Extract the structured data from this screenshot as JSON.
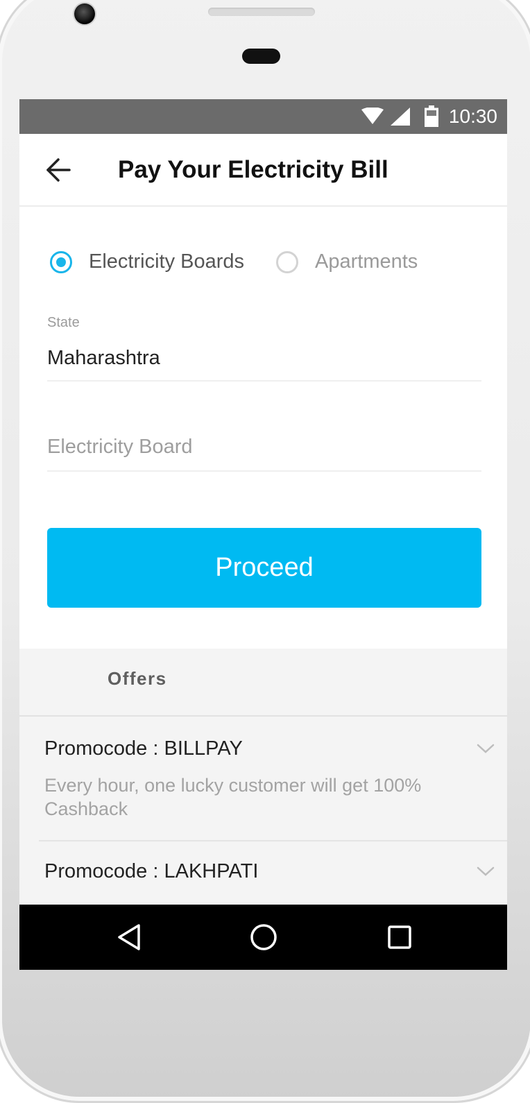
{
  "status_bar": {
    "time": "10:30",
    "icons": [
      "wifi-icon",
      "cellular-signal-icon",
      "battery-icon"
    ],
    "background": "#6b6b6b"
  },
  "app_bar": {
    "back_icon": "arrow-left-icon",
    "title": "Pay Your Electricity Bill"
  },
  "bill_type": {
    "options": [
      {
        "label": "Electricity Boards",
        "selected": true
      },
      {
        "label": "Apartments",
        "selected": false
      }
    ]
  },
  "form": {
    "state": {
      "label": "State",
      "value": "Maharashtra"
    },
    "board": {
      "placeholder": "Electricity Board",
      "value": ""
    }
  },
  "proceed_button": {
    "label": "Proceed",
    "color": "#00baf2"
  },
  "offers": {
    "title": "Offers",
    "items": [
      {
        "code": "Promocode : BILLPAY",
        "description": "Every hour, one lucky customer will get 100% Cashback"
      },
      {
        "code": "Promocode : LAKHPATI",
        "description": ""
      }
    ]
  },
  "nav_bar": {
    "buttons": [
      "back-triangle-icon",
      "home-circle-icon",
      "recents-square-icon"
    ]
  },
  "colors": {
    "accent": "#19b5ea",
    "button": "#00baf2"
  }
}
